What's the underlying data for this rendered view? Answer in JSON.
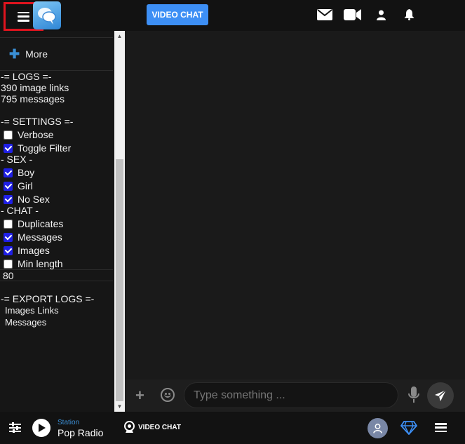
{
  "header": {
    "video_chat_label": "VIDEO CHAT",
    "icons": [
      "menu-icon",
      "app-logo",
      "envelope-icon",
      "video-camera-icon",
      "user-icon",
      "bell-icon"
    ]
  },
  "sidebar": {
    "more_label": "More",
    "logs_heading": "-= LOGS =-",
    "image_links_count": "390 image links",
    "messages_count": "795 messages",
    "settings_heading": "-= SETTINGS =-",
    "settings": [
      {
        "label": "Verbose",
        "checked": false
      },
      {
        "label": "Toggle Filter",
        "checked": true
      }
    ],
    "sex_heading": "- SEX -",
    "sex": [
      {
        "label": "Boy",
        "checked": true
      },
      {
        "label": "Girl",
        "checked": true
      },
      {
        "label": "No Sex",
        "checked": true
      }
    ],
    "chat_heading": "- CHAT -",
    "chat": [
      {
        "label": "Duplicates",
        "checked": false
      },
      {
        "label": "Messages",
        "checked": true
      },
      {
        "label": "Images",
        "checked": true
      },
      {
        "label": "Min length",
        "checked": false
      }
    ],
    "min_length_value": "80",
    "export_heading": "-= EXPORT LOGS =-",
    "export_links": [
      "Images Links",
      "Messages"
    ]
  },
  "composer": {
    "placeholder": "Type something ..."
  },
  "footer": {
    "station_label": "Station",
    "station_name": "Pop Radio",
    "video_chat_label": "VIDEO CHAT"
  },
  "colors": {
    "accent_blue": "#3d8ff5",
    "highlight_red": "#e0141e",
    "checkbox_checked": "#1f1fe6",
    "station_label": "#3c8fd5"
  }
}
